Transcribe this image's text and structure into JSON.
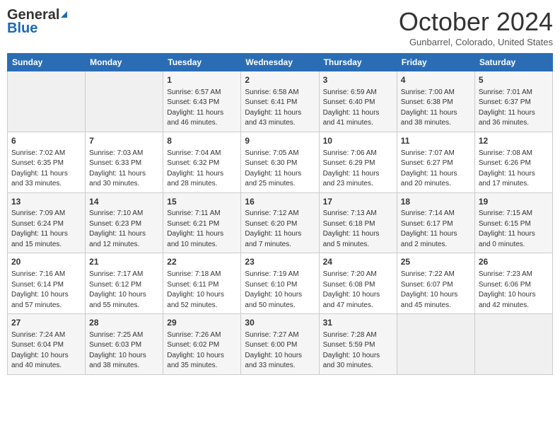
{
  "header": {
    "logo_general": "General",
    "logo_blue": "Blue",
    "title": "October 2024",
    "location": "Gunbarrel, Colorado, United States"
  },
  "days_of_week": [
    "Sunday",
    "Monday",
    "Tuesday",
    "Wednesday",
    "Thursday",
    "Friday",
    "Saturday"
  ],
  "weeks": [
    [
      {
        "day": "",
        "content": ""
      },
      {
        "day": "",
        "content": ""
      },
      {
        "day": "1",
        "content": "Sunrise: 6:57 AM\nSunset: 6:43 PM\nDaylight: 11 hours and 46 minutes."
      },
      {
        "day": "2",
        "content": "Sunrise: 6:58 AM\nSunset: 6:41 PM\nDaylight: 11 hours and 43 minutes."
      },
      {
        "day": "3",
        "content": "Sunrise: 6:59 AM\nSunset: 6:40 PM\nDaylight: 11 hours and 41 minutes."
      },
      {
        "day": "4",
        "content": "Sunrise: 7:00 AM\nSunset: 6:38 PM\nDaylight: 11 hours and 38 minutes."
      },
      {
        "day": "5",
        "content": "Sunrise: 7:01 AM\nSunset: 6:37 PM\nDaylight: 11 hours and 36 minutes."
      }
    ],
    [
      {
        "day": "6",
        "content": "Sunrise: 7:02 AM\nSunset: 6:35 PM\nDaylight: 11 hours and 33 minutes."
      },
      {
        "day": "7",
        "content": "Sunrise: 7:03 AM\nSunset: 6:33 PM\nDaylight: 11 hours and 30 minutes."
      },
      {
        "day": "8",
        "content": "Sunrise: 7:04 AM\nSunset: 6:32 PM\nDaylight: 11 hours and 28 minutes."
      },
      {
        "day": "9",
        "content": "Sunrise: 7:05 AM\nSunset: 6:30 PM\nDaylight: 11 hours and 25 minutes."
      },
      {
        "day": "10",
        "content": "Sunrise: 7:06 AM\nSunset: 6:29 PM\nDaylight: 11 hours and 23 minutes."
      },
      {
        "day": "11",
        "content": "Sunrise: 7:07 AM\nSunset: 6:27 PM\nDaylight: 11 hours and 20 minutes."
      },
      {
        "day": "12",
        "content": "Sunrise: 7:08 AM\nSunset: 6:26 PM\nDaylight: 11 hours and 17 minutes."
      }
    ],
    [
      {
        "day": "13",
        "content": "Sunrise: 7:09 AM\nSunset: 6:24 PM\nDaylight: 11 hours and 15 minutes."
      },
      {
        "day": "14",
        "content": "Sunrise: 7:10 AM\nSunset: 6:23 PM\nDaylight: 11 hours and 12 minutes."
      },
      {
        "day": "15",
        "content": "Sunrise: 7:11 AM\nSunset: 6:21 PM\nDaylight: 11 hours and 10 minutes."
      },
      {
        "day": "16",
        "content": "Sunrise: 7:12 AM\nSunset: 6:20 PM\nDaylight: 11 hours and 7 minutes."
      },
      {
        "day": "17",
        "content": "Sunrise: 7:13 AM\nSunset: 6:18 PM\nDaylight: 11 hours and 5 minutes."
      },
      {
        "day": "18",
        "content": "Sunrise: 7:14 AM\nSunset: 6:17 PM\nDaylight: 11 hours and 2 minutes."
      },
      {
        "day": "19",
        "content": "Sunrise: 7:15 AM\nSunset: 6:15 PM\nDaylight: 11 hours and 0 minutes."
      }
    ],
    [
      {
        "day": "20",
        "content": "Sunrise: 7:16 AM\nSunset: 6:14 PM\nDaylight: 10 hours and 57 minutes."
      },
      {
        "day": "21",
        "content": "Sunrise: 7:17 AM\nSunset: 6:12 PM\nDaylight: 10 hours and 55 minutes."
      },
      {
        "day": "22",
        "content": "Sunrise: 7:18 AM\nSunset: 6:11 PM\nDaylight: 10 hours and 52 minutes."
      },
      {
        "day": "23",
        "content": "Sunrise: 7:19 AM\nSunset: 6:10 PM\nDaylight: 10 hours and 50 minutes."
      },
      {
        "day": "24",
        "content": "Sunrise: 7:20 AM\nSunset: 6:08 PM\nDaylight: 10 hours and 47 minutes."
      },
      {
        "day": "25",
        "content": "Sunrise: 7:22 AM\nSunset: 6:07 PM\nDaylight: 10 hours and 45 minutes."
      },
      {
        "day": "26",
        "content": "Sunrise: 7:23 AM\nSunset: 6:06 PM\nDaylight: 10 hours and 42 minutes."
      }
    ],
    [
      {
        "day": "27",
        "content": "Sunrise: 7:24 AM\nSunset: 6:04 PM\nDaylight: 10 hours and 40 minutes."
      },
      {
        "day": "28",
        "content": "Sunrise: 7:25 AM\nSunset: 6:03 PM\nDaylight: 10 hours and 38 minutes."
      },
      {
        "day": "29",
        "content": "Sunrise: 7:26 AM\nSunset: 6:02 PM\nDaylight: 10 hours and 35 minutes."
      },
      {
        "day": "30",
        "content": "Sunrise: 7:27 AM\nSunset: 6:00 PM\nDaylight: 10 hours and 33 minutes."
      },
      {
        "day": "31",
        "content": "Sunrise: 7:28 AM\nSunset: 5:59 PM\nDaylight: 10 hours and 30 minutes."
      },
      {
        "day": "",
        "content": ""
      },
      {
        "day": "",
        "content": ""
      }
    ]
  ]
}
